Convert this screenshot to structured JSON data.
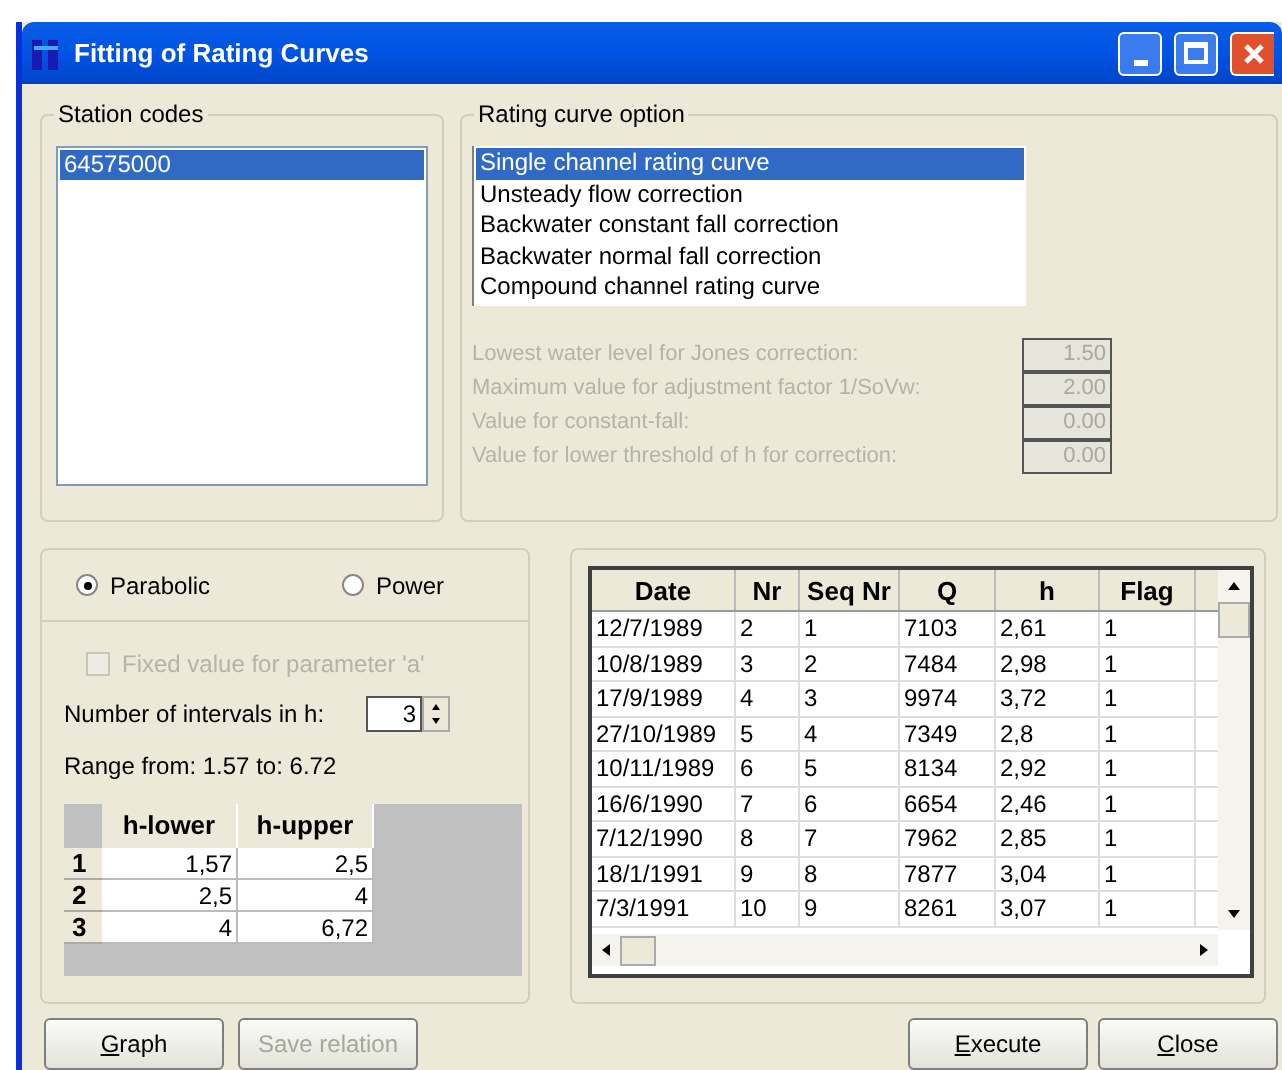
{
  "window": {
    "title": "Fitting of Rating Curves"
  },
  "station_codes": {
    "label": "Station codes",
    "items": [
      {
        "label": "64575000",
        "selected": true
      }
    ]
  },
  "rating_curve_option": {
    "label": "Rating curve option",
    "items": [
      {
        "label": "Single channel rating curve",
        "selected": true
      },
      {
        "label": "Unsteady flow correction",
        "selected": false
      },
      {
        "label": "Backwater constant fall correction",
        "selected": false
      },
      {
        "label": "Backwater normal fall correction",
        "selected": false
      },
      {
        "label": "Compound channel rating curve",
        "selected": false
      }
    ],
    "parameters": [
      {
        "label": "Lowest water level for Jones correction:",
        "value": "1.50",
        "disabled": true
      },
      {
        "label": "Maximum value for adjustment factor 1/SoVw:",
        "value": "2.00",
        "disabled": true
      },
      {
        "label": "Value  for constant-fall:",
        "value": "0.00",
        "disabled": true
      },
      {
        "label": "Value for lower threshold of h for correction:",
        "value": "0.00",
        "disabled": true
      }
    ]
  },
  "curve_type": [
    {
      "label": "Parabolic",
      "selected": true
    },
    {
      "label": "Power",
      "selected": false
    }
  ],
  "fixed_parameter": {
    "label": "Fixed value for parameter 'a'",
    "checked": false,
    "disabled": true
  },
  "intervals": {
    "label": "Number of intervals in h:",
    "value": "3"
  },
  "range": {
    "from_label": "Range from:",
    "from": "1.57",
    "to_label": "to:",
    "to": "6.72"
  },
  "interval_grid": {
    "columns": [
      "h-lower",
      "h-upper"
    ],
    "rows": [
      {
        "nr": "1",
        "cells": [
          "1,57",
          "2,5"
        ]
      },
      {
        "nr": "2",
        "cells": [
          "2,5",
          "4"
        ]
      },
      {
        "nr": "3",
        "cells": [
          "4",
          "6,72"
        ]
      }
    ]
  },
  "table": {
    "columns": [
      "Date",
      "Nr",
      "Seq Nr",
      "Q",
      "h",
      "Flag"
    ],
    "rows": [
      [
        "12/7/1989",
        "2",
        "1",
        "7103",
        "2,61",
        "1"
      ],
      [
        "10/8/1989",
        "3",
        "2",
        "7484",
        "2,98",
        "1"
      ],
      [
        "17/9/1989",
        "4",
        "3",
        "9974",
        "3,72",
        "1"
      ],
      [
        "27/10/1989",
        "5",
        "4",
        "7349",
        "2,8",
        "1"
      ],
      [
        "10/11/1989",
        "6",
        "5",
        "8134",
        "2,92",
        "1"
      ],
      [
        "16/6/1990",
        "7",
        "6",
        "6654",
        "2,46",
        "1"
      ],
      [
        "7/12/1990",
        "8",
        "7",
        "7962",
        "2,85",
        "1"
      ],
      [
        "18/1/1991",
        "9",
        "8",
        "7877",
        "3,04",
        "1"
      ],
      [
        "7/3/1991",
        "10",
        "9",
        "8261",
        "3,07",
        "1"
      ]
    ]
  },
  "left_buttons": [
    {
      "label": "Graph",
      "disabled": false
    },
    {
      "label": "Save relation",
      "disabled": true
    }
  ],
  "right_buttons": [
    {
      "label": "Execute",
      "disabled": false
    },
    {
      "label": "Close",
      "disabled": false
    }
  ]
}
